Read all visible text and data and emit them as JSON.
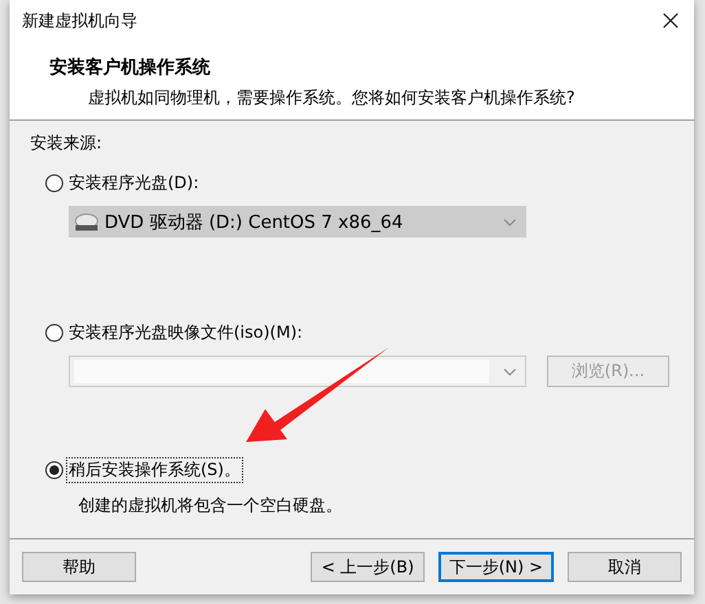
{
  "window": {
    "title": "新建虚拟机向导"
  },
  "header": {
    "title": "安装客户机操作系统",
    "subtitle": "虚拟机如同物理机，需要操作系统。您将如何安装客户机操作系统?"
  },
  "source_label": "安装来源:",
  "options": [
    {
      "kind": "disc",
      "label": "安装程序光盘(D):",
      "selected": false,
      "dropdown": {
        "value": "DVD 驱动器 (D:) CentOS 7 x86_64",
        "disabled": true
      }
    },
    {
      "kind": "image",
      "label": "安装程序光盘映像文件(iso)(M):",
      "selected": false,
      "dropdown": {
        "disabled": true
      },
      "browse_button": {
        "label": "浏览(R)...",
        "disabled": true
      }
    },
    {
      "kind": "later",
      "label": "稍后安装操作系统(S)。",
      "selected": true,
      "description": "创建的虚拟机将包含一个空白硬盘。"
    }
  ],
  "annotation": {
    "kind": "arrow"
  },
  "buttons": [
    {
      "label": "帮助",
      "default": false
    },
    {
      "label": "< 上一步(B)",
      "default": false
    },
    {
      "label": "下一步(N) >",
      "default": true
    },
    {
      "label": "取消",
      "default": false
    }
  ]
}
